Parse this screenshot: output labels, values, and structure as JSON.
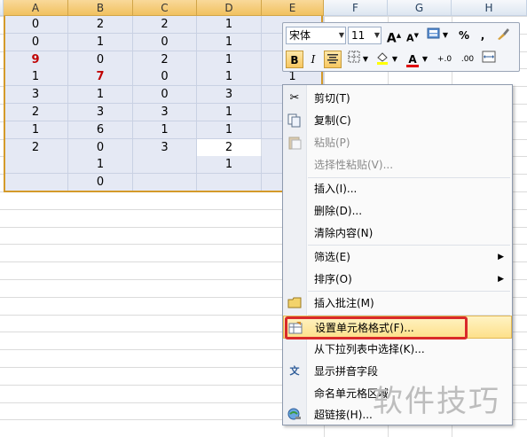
{
  "columns": [
    "A",
    "B",
    "C",
    "D",
    "E",
    "F",
    "G",
    "H"
  ],
  "rows": [
    {
      "a": "0",
      "b": "2",
      "c": "2",
      "d": "1",
      "e": ""
    },
    {
      "a": "0",
      "b": "1",
      "c": "0",
      "d": "1",
      "e": ""
    },
    {
      "a": "9",
      "b": "0",
      "c": "2",
      "d": "1",
      "e": ""
    },
    {
      "a": "1",
      "b": "7",
      "c": "0",
      "d": "1",
      "e": "1"
    },
    {
      "a": "3",
      "b": "1",
      "c": "0",
      "d": "3",
      "e": ""
    },
    {
      "a": "2",
      "b": "3",
      "c": "3",
      "d": "1",
      "e": ""
    },
    {
      "a": "1",
      "b": "6",
      "c": "1",
      "d": "1",
      "e": ""
    },
    {
      "a": "2",
      "b": "0",
      "c": "3",
      "d": "2",
      "e": ""
    },
    {
      "a": "",
      "b": "1",
      "c": "",
      "d": "1",
      "e": ""
    },
    {
      "a": "",
      "b": "0",
      "c": "",
      "d": "",
      "e": ""
    }
  ],
  "highlight_color": "#c00000",
  "toolbar": {
    "font_name": "宋体",
    "font_size": "11",
    "grow_font": "A",
    "shrink_font": "A",
    "percent": "%",
    "comma": ",",
    "bold": "B",
    "italic": "I",
    "font_color_letter": "A",
    "inc_decimal": "+.0",
    "dec_decimal": ".00"
  },
  "context_menu": {
    "cut": "剪切(T)",
    "copy": "复制(C)",
    "paste": "粘贴(P)",
    "paste_special": "选择性粘贴(V)...",
    "insert": "插入(I)...",
    "delete": "删除(D)...",
    "clear": "清除内容(N)",
    "filter": "筛选(E)",
    "sort": "排序(O)",
    "insert_comment": "插入批注(M)",
    "format_cells": "设置单元格格式(F)...",
    "pick_from_list": "从下拉列表中选择(K)...",
    "phonetic": "显示拼音字段",
    "name_range": "命名单元格区域",
    "hyperlink": "超链接(H)..."
  },
  "icons": {
    "cut": "scissors-icon",
    "copy": "copy-icon",
    "paste": "paste-icon",
    "comment": "comment-icon",
    "format": "format-cells-icon",
    "phonetic": "phonetic-icon",
    "hyperlink": "hyperlink-icon"
  },
  "watermark": "软件技巧"
}
